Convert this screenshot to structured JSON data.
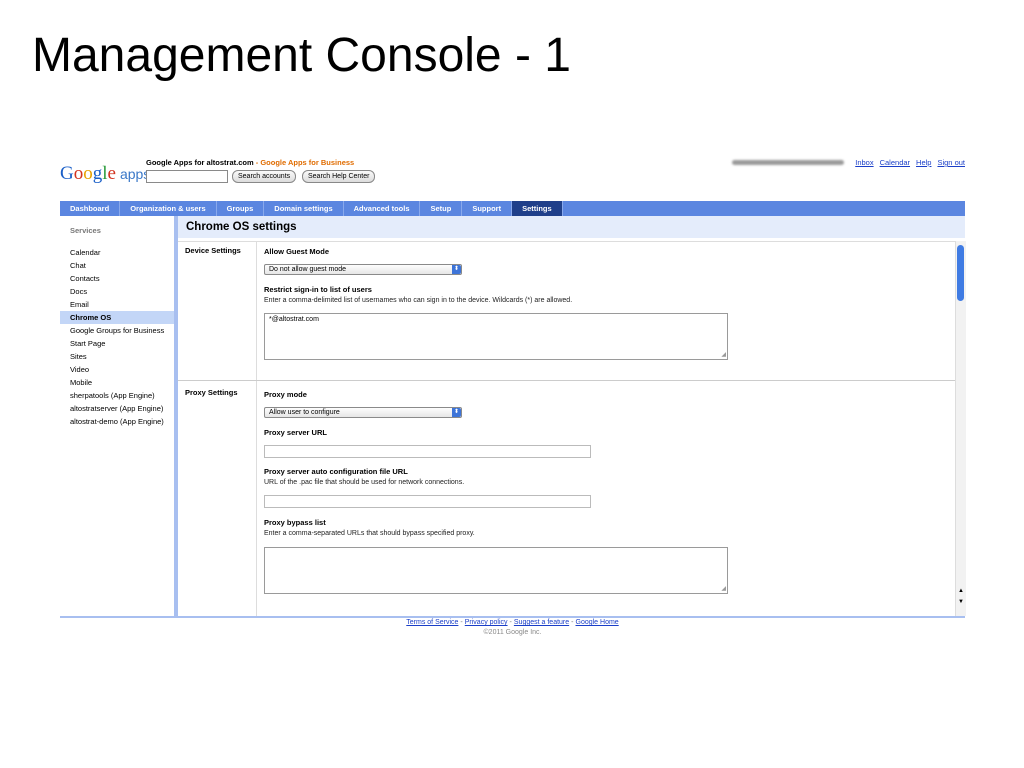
{
  "slide": {
    "title": "Management Console - 1"
  },
  "header": {
    "logo_google": "Google",
    "logo_apps": "apps",
    "domain_text": "Google Apps for altostrat.com",
    "domain_sep": " - ",
    "edition_text": "Google Apps for Business",
    "search_accounts_label": "Search accounts",
    "search_help_label": "Search Help Center",
    "links": [
      "Inbox",
      "Calendar",
      "Help",
      "Sign out"
    ]
  },
  "navbar": {
    "tabs": [
      "Dashboard",
      "Organization & users",
      "Groups",
      "Domain settings",
      "Advanced tools",
      "Setup",
      "Support",
      "Settings"
    ],
    "active": "Settings"
  },
  "sidebar": {
    "heading": "Services",
    "items": [
      "Calendar",
      "Chat",
      "Contacts",
      "Docs",
      "Email",
      "Chrome OS",
      "Google Groups for Business",
      "Start Page",
      "Sites",
      "Video",
      "Mobile",
      "sherpatools (App Engine)",
      "altostratserver (App Engine)",
      "altostrat-demo (App Engine)"
    ],
    "active": "Chrome OS"
  },
  "page": {
    "title": "Chrome OS settings"
  },
  "device_settings": {
    "label": "Device Settings",
    "guest_mode_label": "Allow Guest Mode",
    "guest_mode_value": "Do not allow guest mode",
    "restrict_label": "Restrict sign-in to list of users",
    "restrict_help": "Enter a comma-delimited list of usernames who can sign in to the device. Wildcards (*) are allowed.",
    "restrict_value": "*@altostrat.com"
  },
  "proxy_settings": {
    "label": "Proxy Settings",
    "mode_label": "Proxy mode",
    "mode_value": "Allow user to configure",
    "server_url_label": "Proxy server URL",
    "auto_config_label": "Proxy server auto configuration file URL",
    "auto_config_help": "URL of the .pac file that should be used for network connections.",
    "bypass_label": "Proxy bypass list",
    "bypass_help": "Enter a comma-separated URLs that should bypass specified proxy."
  },
  "footer": {
    "links": [
      "Terms of Service",
      "Privacy policy",
      "Suggest a feature",
      "Google Home"
    ],
    "separator": "-",
    "copyright": "©2011 Google Inc."
  }
}
